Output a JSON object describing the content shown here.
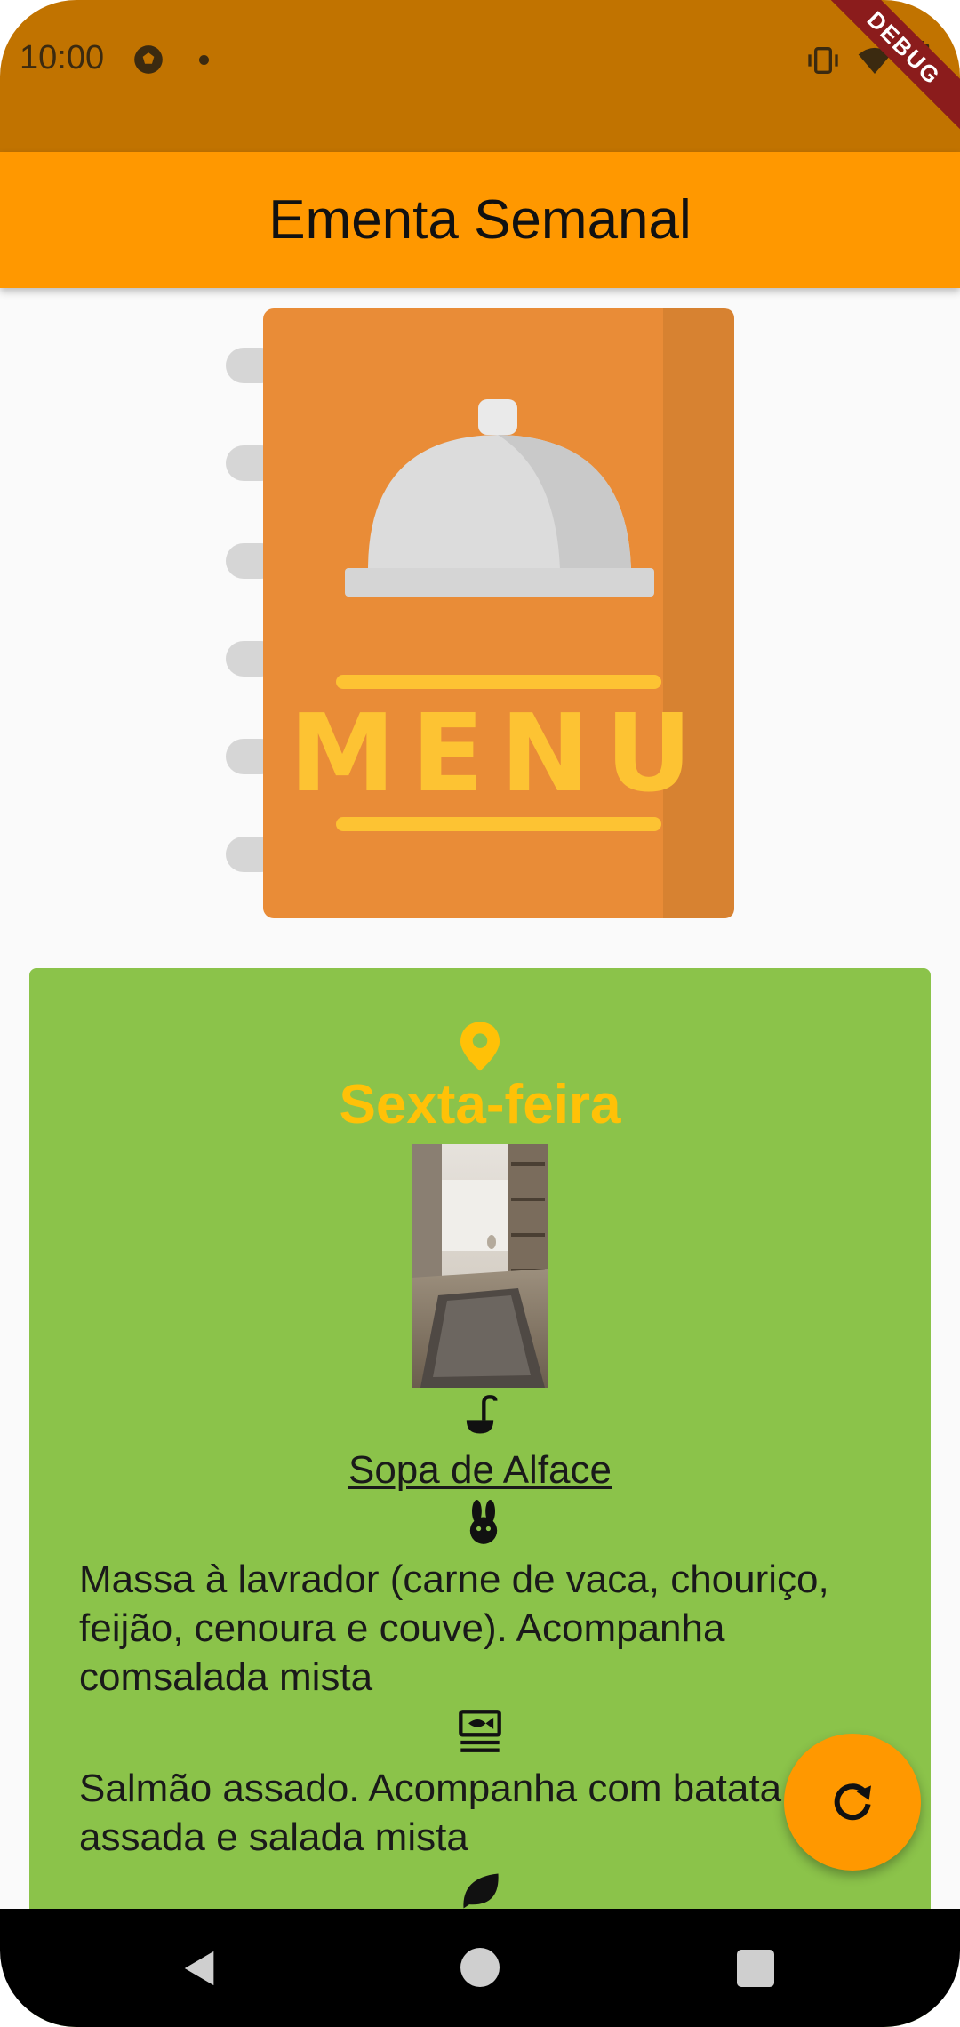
{
  "status_bar": {
    "time": "10:00",
    "debug_label": "DEBUG"
  },
  "app_bar": {
    "title": "Ementa Semanal"
  },
  "illustration": {
    "menu_word": "MENU"
  },
  "day_card": {
    "day": "Sexta-feira",
    "soup": "Sopa de Alface",
    "meat_dish": "Massa à lavrador (carne de vaca, chouriço, feijão, cenoura e couve). Acompanha comsalada mista",
    "fish_dish": "Salmão assado. Acompanha com batata assada e salada mista",
    "icons": [
      "location-pin-icon",
      "soup-ladle-icon",
      "rabbit-icon",
      "fish-icon",
      "leaf-icon"
    ]
  },
  "fab": {
    "icon": "refresh-icon"
  },
  "colors": {
    "status_bar": "#c17300",
    "app_bar": "#ff9800",
    "card": "#8bc34a",
    "day_title": "#ffc107",
    "fab": "#ff9800"
  }
}
